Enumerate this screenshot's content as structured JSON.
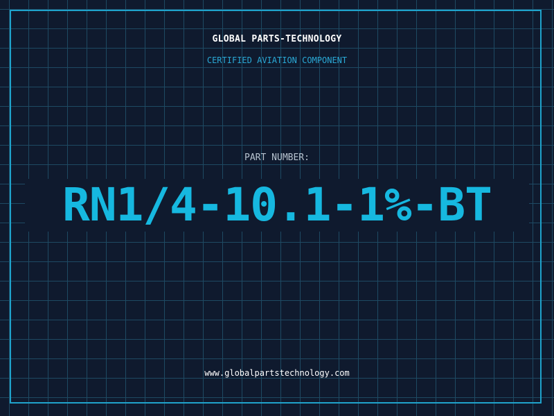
{
  "header": {
    "company": "GLOBAL PARTS-TECHNOLOGY",
    "certification": "CERTIFIED AVIATION COMPONENT"
  },
  "part": {
    "label": "PART NUMBER:",
    "number": "RN1/4-10.1-1%-BT"
  },
  "footer": {
    "website": "www.globalpartstechnology.com"
  },
  "colors": {
    "background": "#0f1a2e",
    "grid": "#1e4a63",
    "accent": "#16b8e0",
    "frame": "#1fa3cc"
  }
}
